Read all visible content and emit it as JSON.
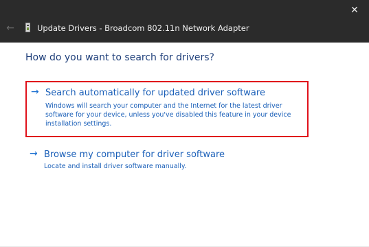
{
  "window": {
    "title": "Update Drivers - Broadcom 802.11n Network Adapter",
    "close_icon": "close-icon",
    "back_icon": "back-arrow-icon",
    "device_icon": "network-adapter-icon"
  },
  "page": {
    "heading": "How do you want to search for drivers?"
  },
  "options": [
    {
      "title": "Search automatically for updated driver software",
      "description": "Windows will search your computer and the Internet for the latest driver software for your device, unless you've disabled this feature in your device installation settings.",
      "icon": "arrow-right-icon",
      "highlighted": true
    },
    {
      "title": "Browse my computer for driver software",
      "description": "Locate and install driver software manually.",
      "icon": "arrow-right-icon",
      "highlighted": false
    }
  ],
  "colors": {
    "titlebar": "#2b2b2b",
    "link_blue": "#1a5fb8",
    "heading_blue": "#1f3f7a",
    "highlight_red": "#e0101a"
  }
}
